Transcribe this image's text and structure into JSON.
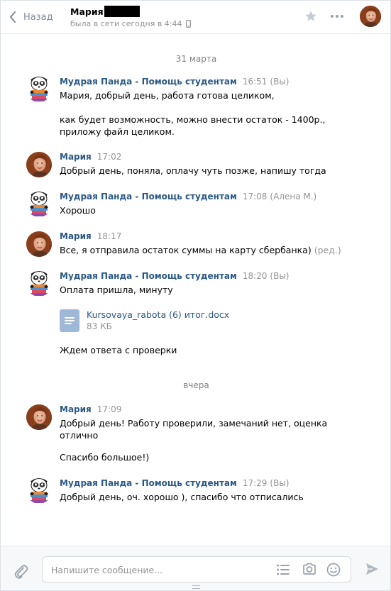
{
  "header": {
    "back_label": "Назад",
    "peer_name": "Мария",
    "peer_status": "была в сети сегодня в 4:44"
  },
  "feed": {
    "groups": [
      {
        "date": "31 марта",
        "messages": [
          {
            "author": "Мудрая Панда - Помощь студентам",
            "time": "16:51",
            "note": "(Вы)",
            "lines": [
              "Мария, добрый день, работа готова целиком,",
              "как будет возможность, можно внести остаток - 1400р.,",
              "приложу файл целиком."
            ]
          },
          {
            "author": "Мария",
            "time": "17:02",
            "lines": [
              "Добрый день, поняла, оплачу чуть позже, напишу тогда"
            ]
          },
          {
            "author": "Мудрая Панда - Помощь студентам",
            "time": "17:08",
            "note": "(Алена М.)",
            "lines": [
              "Хорошо"
            ]
          },
          {
            "author": "Мария",
            "time": "18:17",
            "lines": [
              "Все, я отправила остаток суммы на карту сбербанка)"
            ],
            "edited": "(ред.)"
          },
          {
            "author": "Мудрая Панда - Помощь студентам",
            "time": "18:20",
            "note": "(Вы)",
            "lines": [
              "Оплата пришла, минуту"
            ],
            "attachment": {
              "name": "Kursovaya_rabota (6) итог.docx",
              "size": "83 КБ"
            },
            "after_attachment": "Ждем ответа с проверки"
          }
        ]
      },
      {
        "date": "вчера",
        "messages": [
          {
            "author": "Мария",
            "time": "17:09",
            "lines": [
              "Добрый день! Работу проверили, замечаний нет, оценка",
              "отлично",
              "Спасибо большое!)"
            ]
          },
          {
            "author": "Мудрая Панда - Помощь студентам",
            "time": "17:29",
            "note": "(Вы)",
            "lines": [
              "Добрый день, оч. хорошо ), спасибо что отписались"
            ]
          }
        ]
      }
    ]
  },
  "composer": {
    "placeholder": "Напишите сообщение..."
  },
  "icons": {
    "back": "chevron-left-icon",
    "star": "star-icon",
    "more": "more-dots-icon",
    "phone": "mobile-phone-icon",
    "attach": "paperclip-icon",
    "templates": "list-icon",
    "camera": "camera-icon",
    "emoji": "smile-icon",
    "send": "send-icon",
    "document": "document-icon"
  },
  "colors": {
    "link": "#2a5885",
    "muted": "#939393",
    "doc_icon": "#a0b8d8"
  }
}
